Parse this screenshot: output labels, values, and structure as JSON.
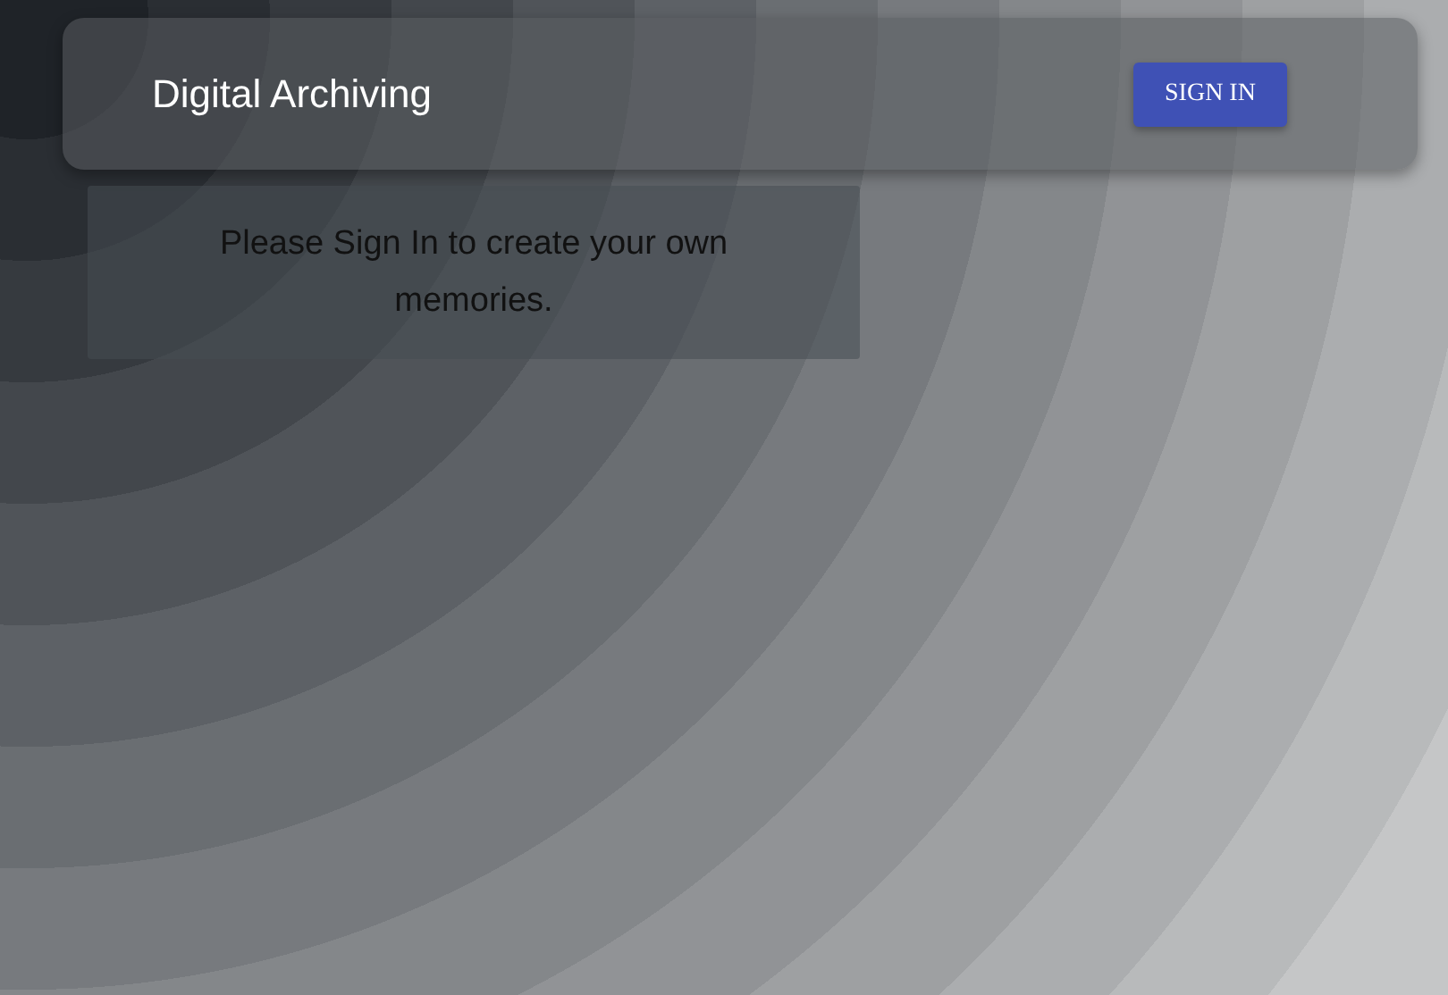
{
  "header": {
    "title": "Digital Archiving",
    "sign_in_button": "SIGN IN"
  },
  "message": "Please Sign In to create your own memories."
}
